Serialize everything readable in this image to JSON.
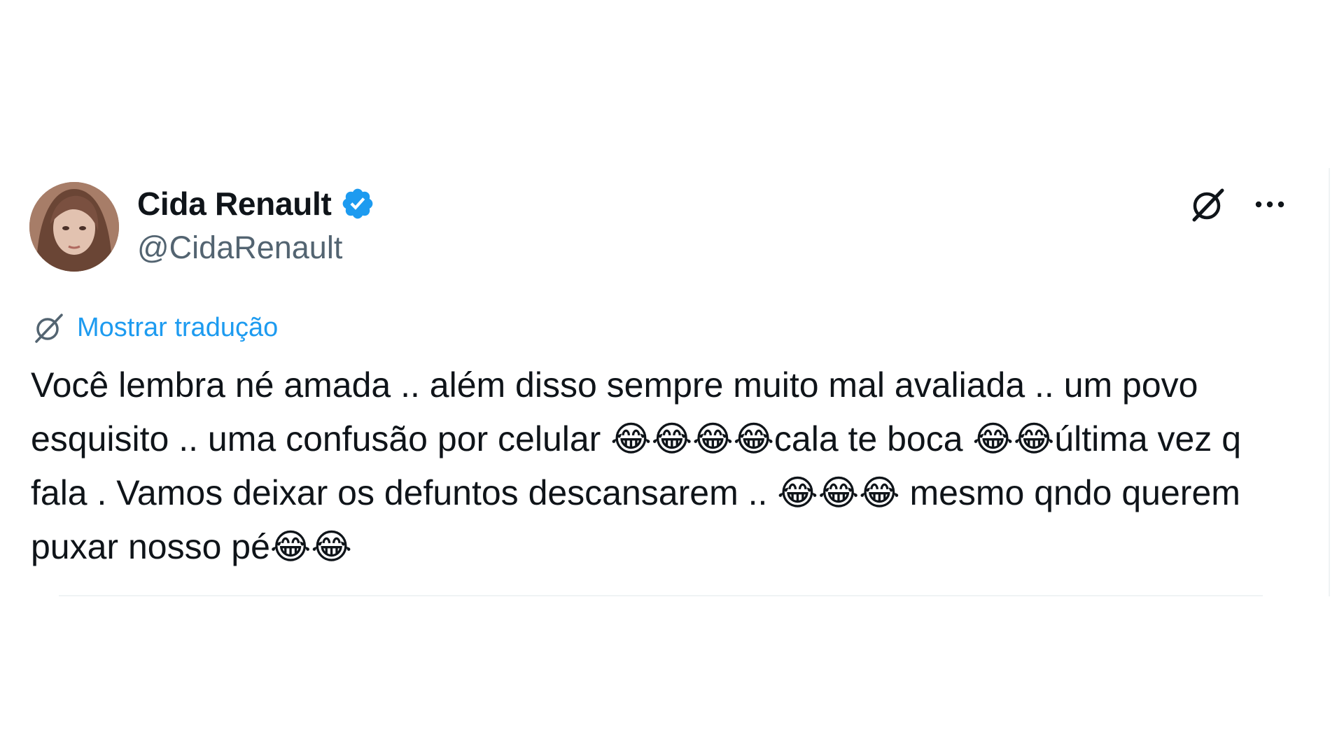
{
  "tweet": {
    "author": {
      "display_name": "Cida Renault",
      "handle": "@CidaRenault",
      "verified": true,
      "verified_color": "#1d9bf0"
    },
    "translate_label": "Mostrar tradução",
    "text": "Você lembra né amada .. além disso sempre muito mal avaliada .. um povo esquisito .. uma confusão por celular 😂😂😂😂cala te boca 😂😂última vez q fala . Vamos deixar os defuntos descansarem .. 😂😂😂 mesmo qndo querem puxar nosso pé😂😂",
    "icons": {
      "grok": "grok-icon",
      "more": "more-options-icon",
      "translate": "translate-icon",
      "verified": "verified-badge-icon"
    }
  },
  "colors": {
    "link": "#1d9bf0",
    "secondary_text": "#536471",
    "primary_text": "#0f1419",
    "divider": "#eff3f4"
  }
}
